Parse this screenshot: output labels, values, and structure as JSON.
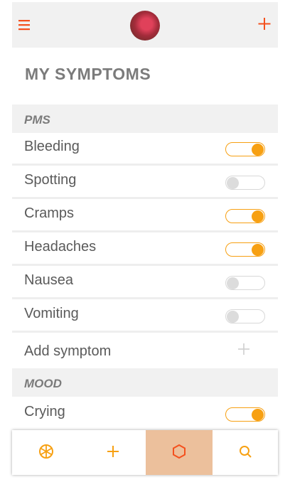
{
  "header": {
    "menu_icon": "hamburger-menu-icon",
    "add_icon": "plus-icon",
    "accent_color": "#f4511e"
  },
  "page": {
    "title": "MY SYMPTOMS"
  },
  "sections": [
    {
      "label": "PMS",
      "items": [
        {
          "label": "Bleeding",
          "enabled": true
        },
        {
          "label": "Spotting",
          "enabled": false
        },
        {
          "label": "Cramps",
          "enabled": true
        },
        {
          "label": "Headaches",
          "enabled": true
        },
        {
          "label": "Nausea",
          "enabled": false
        },
        {
          "label": "Vomiting",
          "enabled": false
        }
      ],
      "add_label": "Add symptom"
    },
    {
      "label": "MOOD",
      "items": [
        {
          "label": "Crying",
          "enabled": true
        }
      ]
    }
  ],
  "colors": {
    "toggle_on": "#f7a012",
    "toggle_off": "#d8d8d8",
    "active_tab_bg": "#ecc09c"
  },
  "bottom_nav": [
    {
      "icon": "aperture-icon",
      "active": false
    },
    {
      "icon": "plus-icon",
      "active": false
    },
    {
      "icon": "hexagon-icon",
      "active": true
    },
    {
      "icon": "search-icon",
      "active": false
    }
  ]
}
